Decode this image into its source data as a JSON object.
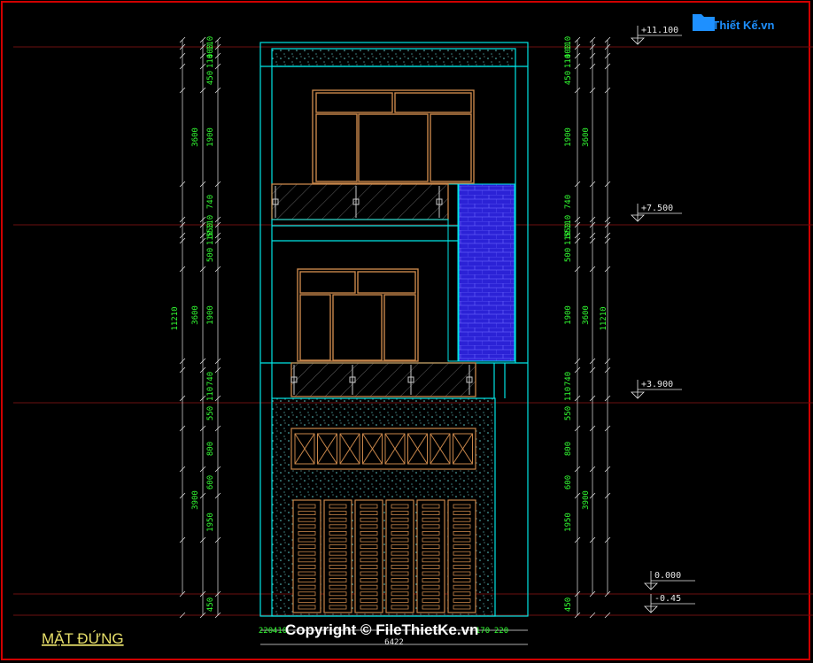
{
  "title": "MẶT ĐỨNG",
  "copyright": "Copyright © FileThietKe.vn",
  "logo": {
    "text": "FileThiết Kế.vn"
  },
  "levels": [
    "+11.100",
    "+7.500",
    "+3.900",
    "0.000",
    "-0.45"
  ],
  "dims_left_inner": [
    "110",
    "400",
    "110",
    "450",
    "1900",
    "740",
    "110",
    "550",
    "110",
    "500",
    "1900",
    "740",
    "110",
    "550",
    "800",
    "600",
    "1950",
    "450"
  ],
  "dims_left_outer": [
    "3600",
    "3600",
    "3900"
  ],
  "dims_total": "11210",
  "dims_bottom": [
    "220",
    "410",
    "170",
    "220"
  ],
  "dims_bottom_total": "6422",
  "colors": {
    "frame": "#d00000",
    "dim": "#33ff33",
    "wall": "#00e5e5",
    "window": "#c8864a",
    "brick": "#2b22d6"
  }
}
